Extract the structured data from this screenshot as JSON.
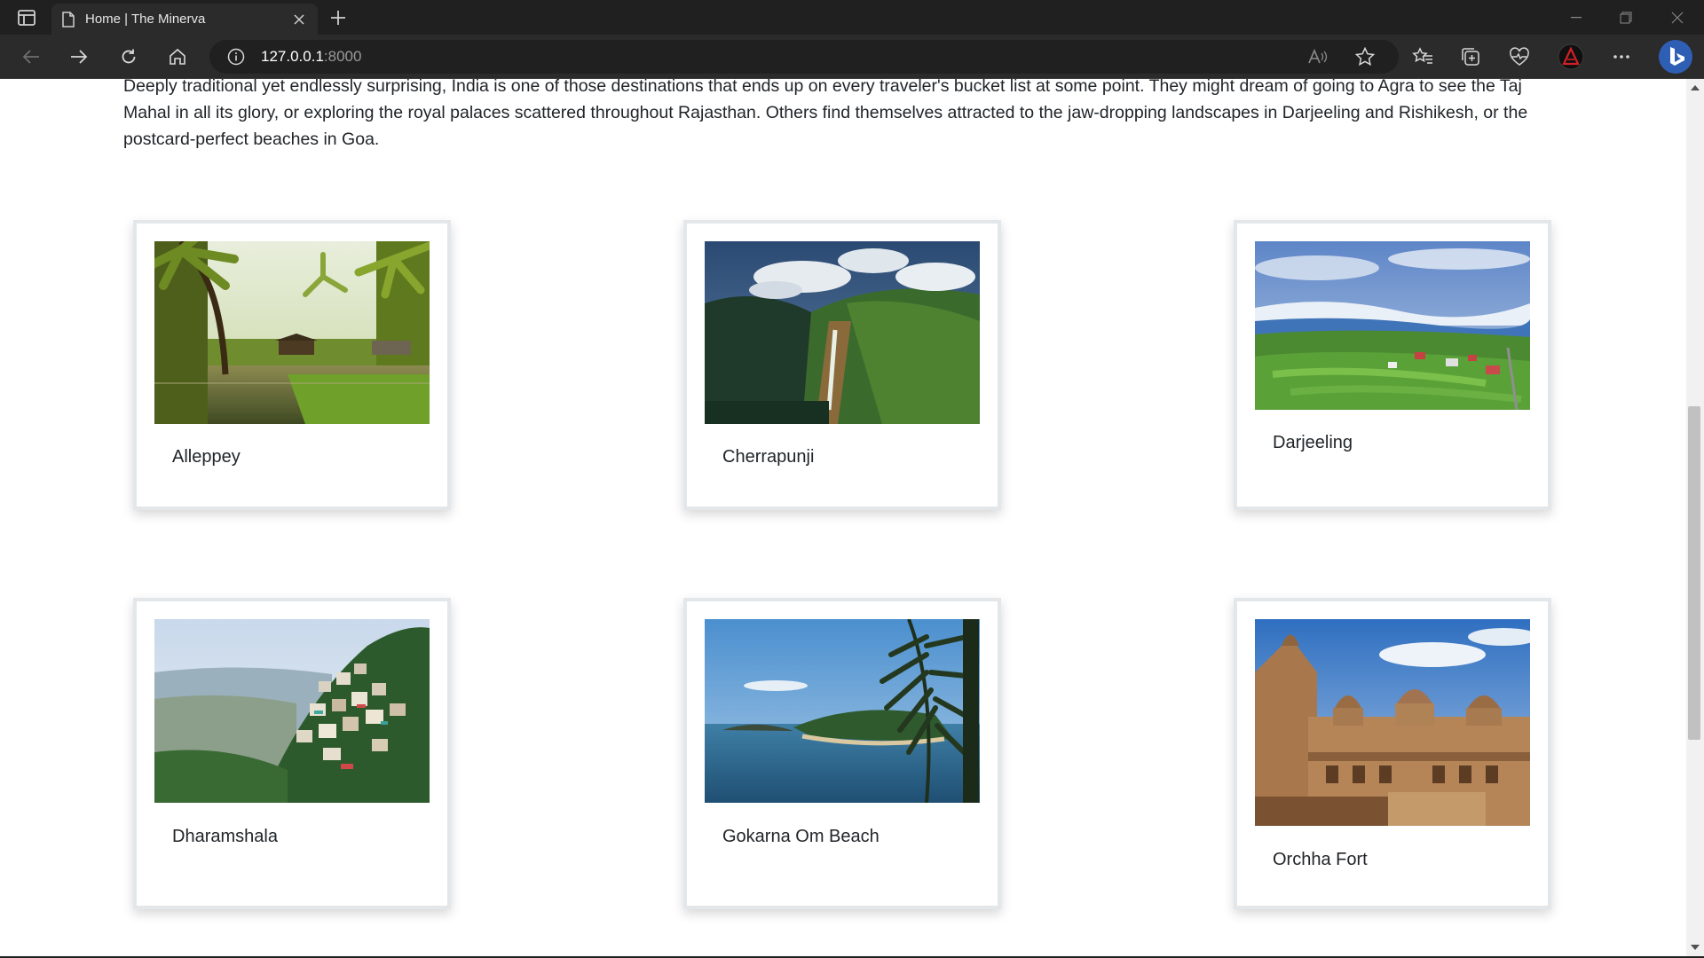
{
  "browser": {
    "tab_title": "Home | The Minerva",
    "url_host": "127.0.0.1",
    "url_port": ":8000"
  },
  "page": {
    "intro": "Deeply traditional yet endlessly surprising, India is one of those destinations that ends up on every traveler's bucket list at some point. They might dream of going to Agra to see the Taj Mahal in all its glory, or exploring the royal palaces scattered throughout Rajasthan. Others find themselves attracted to the jaw-dropping landscapes in Darjeeling and Rishikesh, or the postcard-perfect beaches in Goa.",
    "destinations": [
      {
        "name": "Alleppey",
        "image": "backwaters-photo"
      },
      {
        "name": "Cherrapunji",
        "image": "waterfall-photo"
      },
      {
        "name": "Darjeeling",
        "image": "hills-photo"
      },
      {
        "name": "Dharamshala",
        "image": "hillside-town-photo"
      },
      {
        "name": "Gokarna Om Beach",
        "image": "beach-photo"
      },
      {
        "name": "Orchha Fort",
        "image": "fort-photo"
      }
    ]
  },
  "colors": {
    "chrome_dark": "#202020",
    "chrome_tab": "#2b2b2b",
    "card_border": "#e4e7ea",
    "text": "#212529"
  }
}
